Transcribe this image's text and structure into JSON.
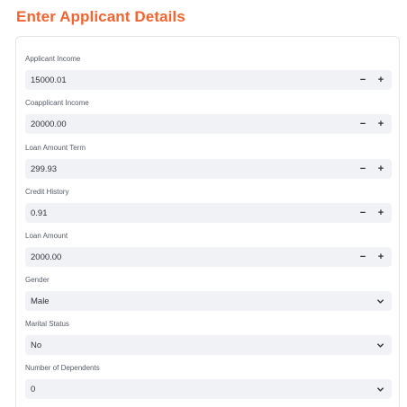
{
  "title": "Enter Applicant Details",
  "fields": {
    "applicant_income": {
      "label": "Applicant Income",
      "value": "15000.01",
      "minus": "−",
      "plus": "+"
    },
    "coapplicant_income": {
      "label": "Coapplicant Income",
      "value": "20000.00",
      "minus": "−",
      "plus": "+"
    },
    "loan_amount_term": {
      "label": "Loan Amount Term",
      "value": "299.93",
      "minus": "−",
      "plus": "+"
    },
    "credit_history": {
      "label": "Credit History",
      "value": "0.91",
      "minus": "−",
      "plus": "+"
    },
    "loan_amount": {
      "label": "Loan Amount",
      "value": "2000.00",
      "minus": "−",
      "plus": "+"
    },
    "gender": {
      "label": "Gender",
      "selected": "Male",
      "icon": "chevron-down-icon"
    },
    "marital_status": {
      "label": "Marital Status",
      "selected": "No",
      "icon": "chevron-down-icon"
    },
    "dependents": {
      "label": "Number of Dependents",
      "selected": "0",
      "icon": "chevron-down-icon"
    }
  },
  "colors": {
    "title": "#f26430",
    "input_bg": "#f0f2f6",
    "text": "#31333f",
    "label": "#555b66",
    "border": "#e3e4e8"
  }
}
